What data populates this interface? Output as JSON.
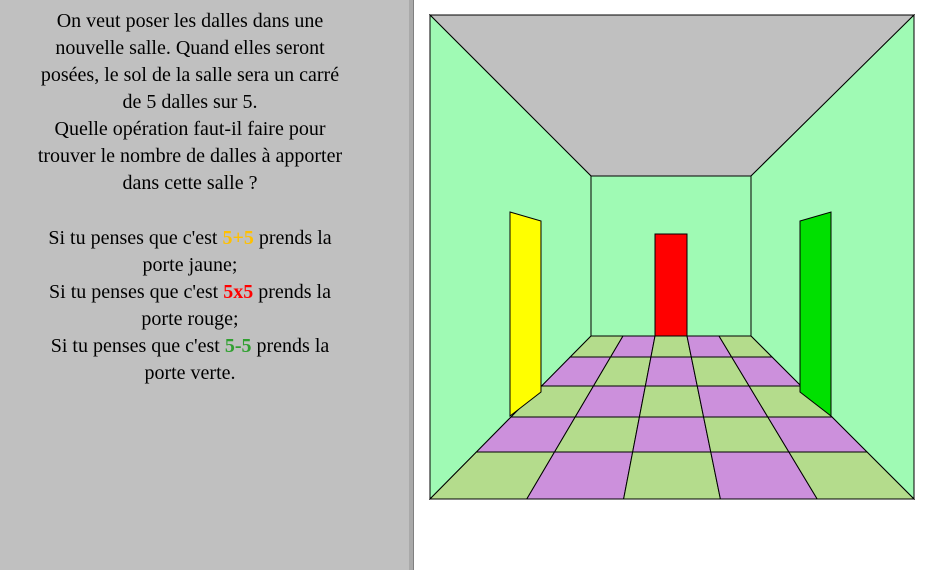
{
  "question": {
    "lines": [
      "On veut poser les dalles dans une",
      "nouvelle salle. Quand elles seront",
      "posées, le sol de la salle sera un carré",
      "de 5 dalles sur 5.",
      "Quelle opération faut-il faire pour",
      "trouver le nombre de dalles à apporter",
      "dans cette salle ?"
    ]
  },
  "choices": [
    {
      "prefix": "Si tu penses que c'est ",
      "op": "5+5",
      "suffix": " prends la",
      "line2": "porte jaune;",
      "color": "#ffc000"
    },
    {
      "prefix": "Si tu penses que c'est ",
      "op": "5x5",
      "suffix": " prends la",
      "line2": "porte rouge;",
      "color": "#ff0000"
    },
    {
      "prefix": "Si tu penses que c'est ",
      "op": "5-5",
      "suffix": " prends la",
      "line2": "porte verte.",
      "color": "#30a030"
    }
  ],
  "room": {
    "ceiling_color": "#c0c0c0",
    "wall_color": "#9ffab4",
    "tile_green": "#b4dc8c",
    "tile_purple": "#cc90dc",
    "doors": {
      "yellow": "#ffff00",
      "red": "#ff0000",
      "green": "#00e000"
    }
  }
}
